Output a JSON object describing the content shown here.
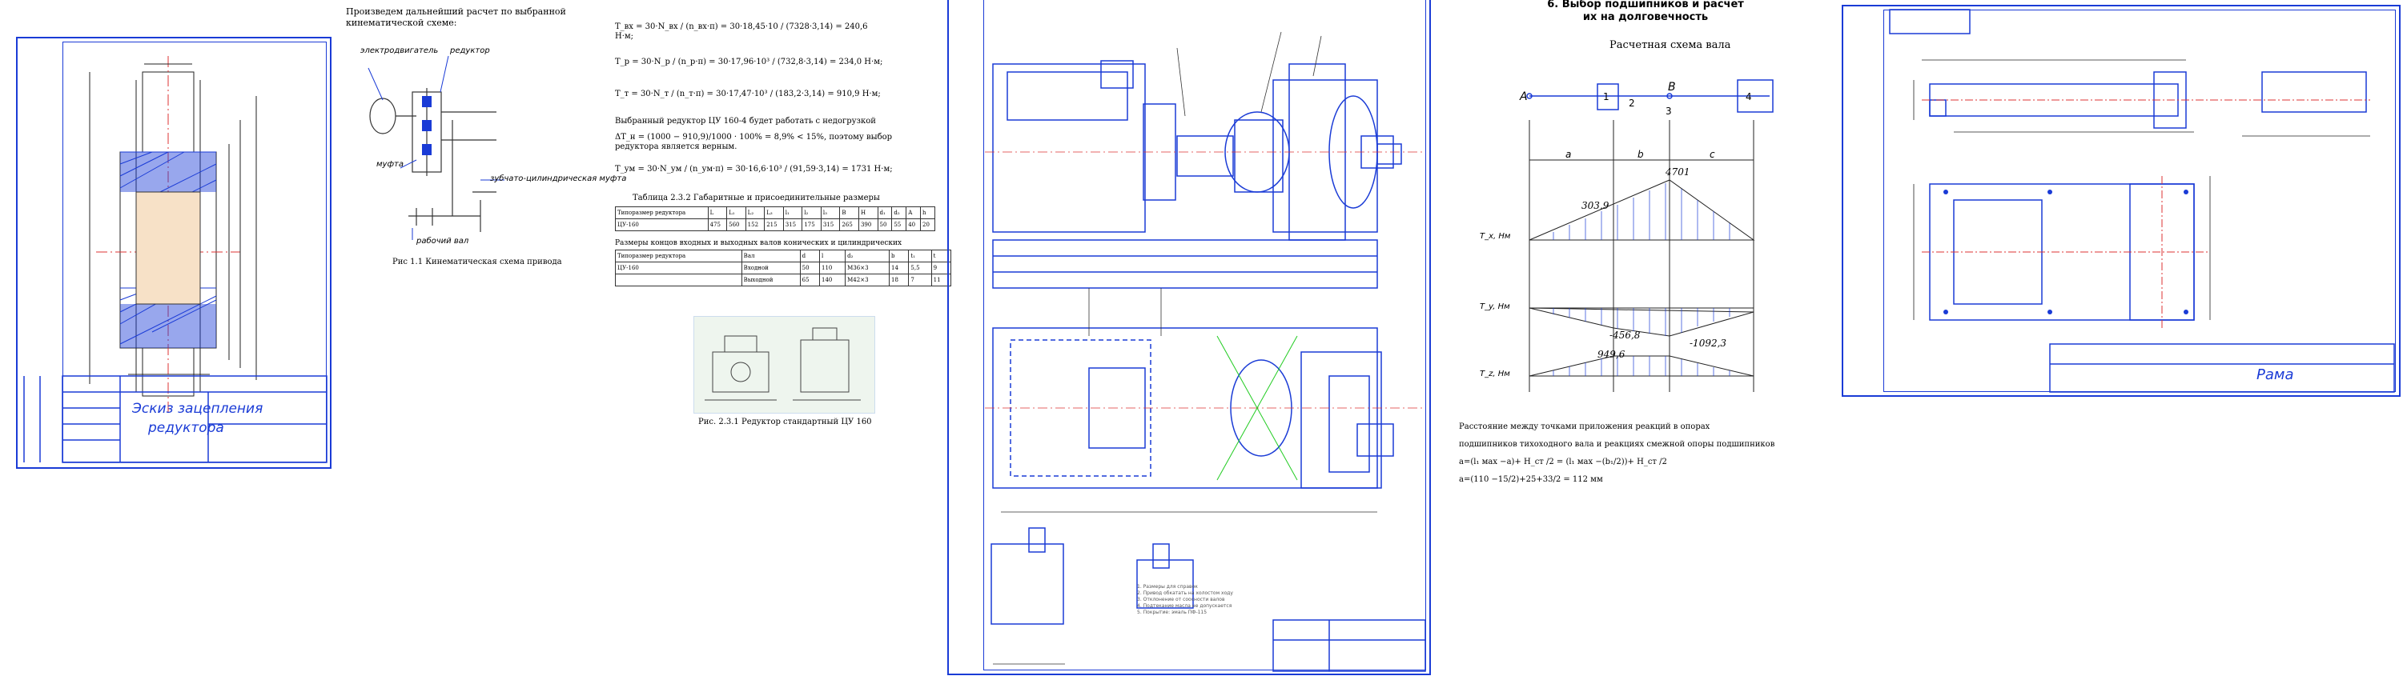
{
  "sheet1": {
    "title_line1": "Эскиз зацепления",
    "title_line2": "редуктора"
  },
  "text_page": {
    "heading": "Произведем дальнейший расчет по выбранной кинематической схеме:",
    "labels": {
      "motor": "электродвигатель",
      "reducer": "редуктор",
      "coupling": "муфта",
      "gear_coupling": "зубчато-цилиндрическая муфта",
      "working_shaft": "рабочий вал"
    },
    "fig1_caption": "Рис 1.1 Кинематическая схема привода",
    "formulas": [
      "T_вх = 30·N_вх / (n_вх·π) = 30·18,45·10 / (7328·3,14) = 240,6 Н·м;",
      "T_р = 30·N_р / (n_р·π) = 30·17,96·10³ / (732,8·3,14) = 234,0 Н·м;",
      "T_т = 30·N_т / (n_т·π) = 30·17,47·10³ / (183,2·3,14) = 910,9 Н·м;"
    ],
    "para1": "Выбранный редуктор ЦУ 160-4 будет работать с недогрузкой",
    "para2": "ΔT_н = (1000 − 910,9)/1000 · 100% = 8,9% < 15%, поэтому выбор редуктора является верным.",
    "formula4": "T_ум = 30·N_ум / (n_ум·π) = 30·16,6·10³ / (91,59·3,14) = 1731 Н·м;",
    "table1_caption": "Таблица 2.3.2 Габаритные и присоединительные размеры",
    "table1_headers": [
      "Типоразмер редуктора",
      "L",
      "L₁",
      "L₂",
      "L₃",
      "l₁",
      "l₂",
      "l₃",
      "B",
      "H",
      "d₁",
      "d₂",
      "A",
      "h"
    ],
    "table1_row": [
      "ЦУ-160",
      "475",
      "560",
      "152",
      "215",
      "315",
      "175",
      "315",
      "265",
      "390",
      "50",
      "55",
      "40",
      "20"
    ],
    "table2_caption": "Размеры концов входных и выходных валов конических и цилиндрических",
    "table2_headers": [
      "Типоразмер редуктора",
      "Вал",
      "d",
      "l",
      "d₂",
      "b",
      "t₁",
      "t"
    ],
    "table2_rows": [
      [
        "ЦУ-160",
        "Входной",
        "50",
        "110",
        "М36×3",
        "14",
        "5,5",
        "9"
      ],
      [
        "",
        "Выходной",
        "65",
        "140",
        "М42×3",
        "18",
        "7",
        "11"
      ]
    ],
    "fig2_caption": "Рис. 2.3.1 Редуктор стандартный ЦУ 160"
  },
  "assembly_sheet": {
    "notes": [
      "1. Размеры для справок",
      "2. Привод обкатать на холостом ходу",
      "3. Отклонение от соосности валов",
      "4. Подтекание масла не допускается",
      "5. Покрытие: эмаль ПФ-115"
    ]
  },
  "bearing_page": {
    "heading": "6. Выбор подшипников и расчет их на долговечность",
    "subheading": "Расчетная схема вала",
    "points": [
      "A",
      "1",
      "2",
      "B",
      "3",
      "4"
    ],
    "spans": [
      "a",
      "b",
      "c"
    ],
    "values": {
      "m1": "4701",
      "m2": "303,9",
      "m3": "-456,8",
      "m4": "-1092,3",
      "m5": "949,6"
    },
    "diagram_labels": [
      "T_x, Нм",
      "T_y, Нм",
      "T_z, Нм"
    ],
    "text1": "Расстояние между точками приложения реакций в опорах",
    "text2": "подшипников тихоходного вала и реакциях смежной опоры подшипников",
    "text3": "a=(l₁ мах −a)+ H_ст /2 = (l₁ мах −(b₁/2))+ H_ст /2",
    "text4": "a=(110 −15/2)+25+33/2 = 112 мм"
  },
  "frame_sheet": {
    "title": "Рама"
  }
}
